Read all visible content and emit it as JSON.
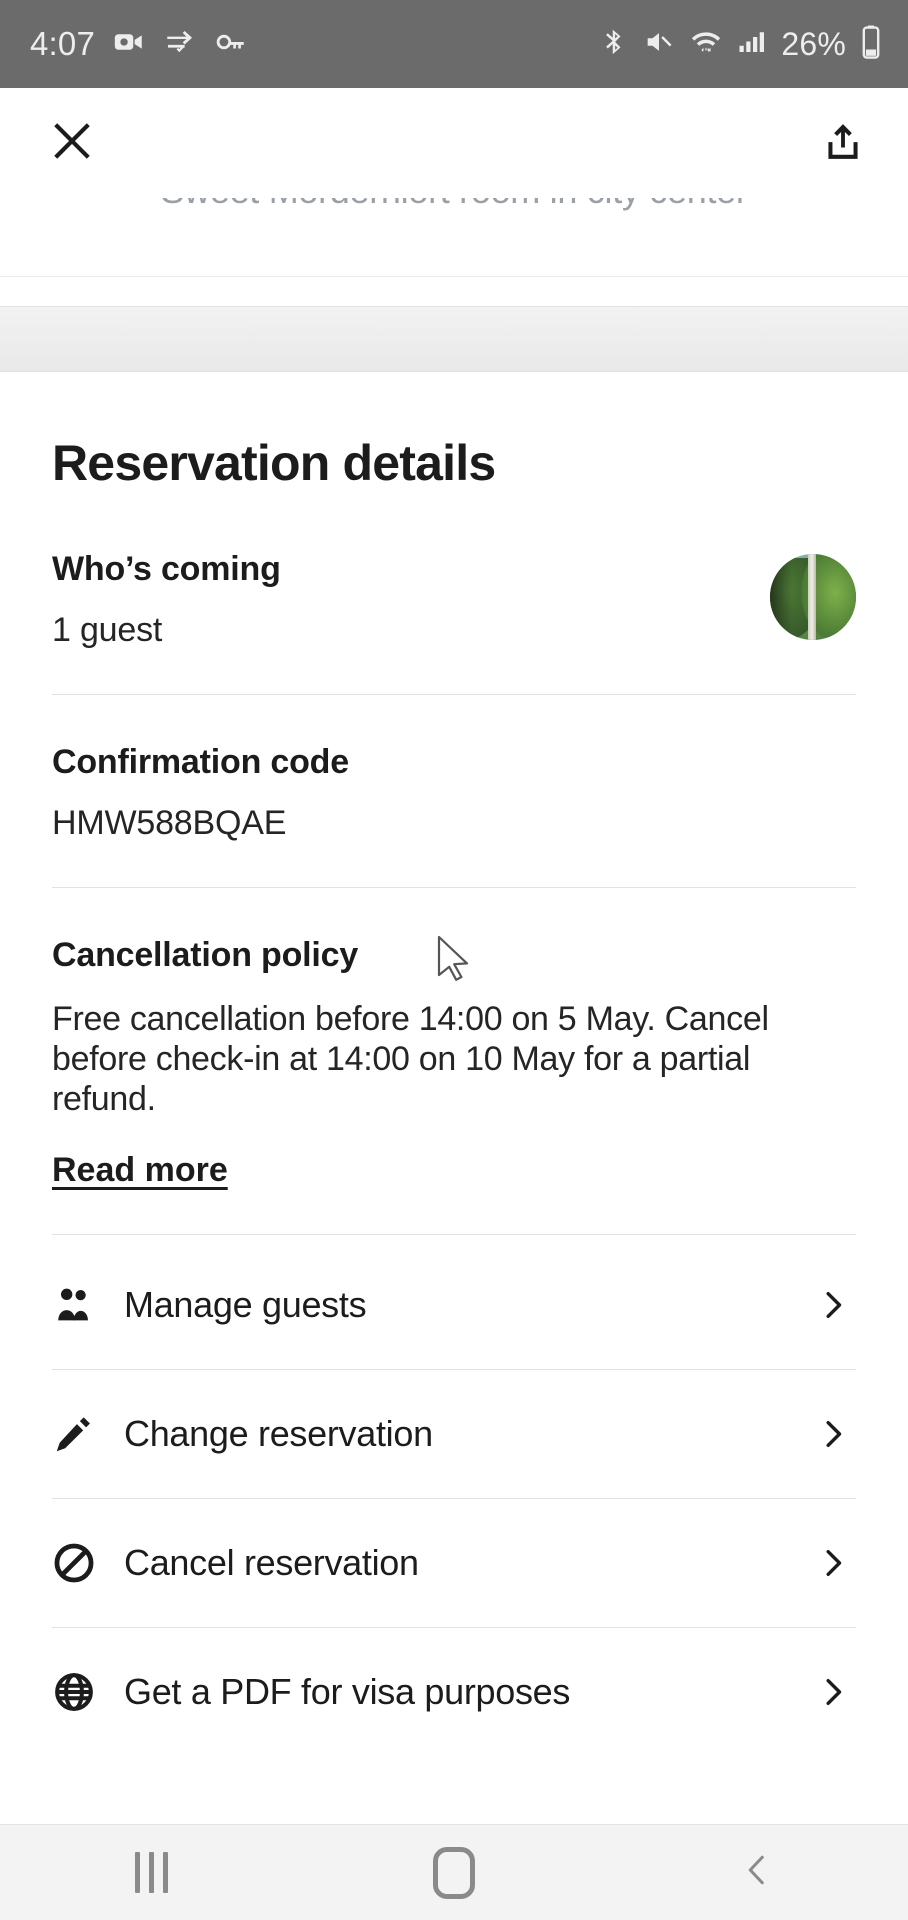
{
  "status_bar": {
    "clock": "4:07",
    "battery_percent": "26%",
    "left_icons": [
      "video-camera-icon",
      "vpn-icon",
      "key-icon"
    ],
    "right_icons": [
      "bluetooth-icon",
      "volume-mute-icon",
      "wifi-icon",
      "cellular-signal-icon",
      "battery-icon"
    ]
  },
  "app_bar": {
    "close_icon": "close-icon",
    "share_icon": "share-icon"
  },
  "listing": {
    "title": "Sweet Mordernlort room in city center"
  },
  "details": {
    "page_title": "Reservation details",
    "guests": {
      "label": "Who’s coming",
      "value": "1 guest",
      "avatar_alt": "guest-avatar"
    },
    "confirmation": {
      "label": "Confirmation code",
      "value": "HMW588BQAE"
    },
    "cancellation": {
      "label": "Cancellation policy",
      "text": "Free cancellation before 14:00 on 5 May. Cancel before check-in at 14:00 on 10 May for a partial refund.",
      "read_more": "Read more"
    }
  },
  "actions": [
    {
      "icon": "people-icon",
      "label": "Manage guests",
      "chevron": "chevron-right-icon"
    },
    {
      "icon": "pencil-icon",
      "label": "Change reservation",
      "chevron": "chevron-right-icon"
    },
    {
      "icon": "no-entry-icon",
      "label": "Cancel reservation",
      "chevron": "chevron-right-icon"
    },
    {
      "icon": "globe-icon",
      "label": "Get a PDF for visa purposes",
      "chevron": "chevron-right-icon"
    }
  ],
  "nav_bar": {
    "recents": "recents-icon",
    "home": "home-icon",
    "back": "back-icon"
  },
  "colors": {
    "status_bar_bg": "#6b6b6b",
    "text_primary": "#1c1c1c",
    "divider": "#e2e2e2",
    "nav_bg": "#f3f3f3"
  }
}
